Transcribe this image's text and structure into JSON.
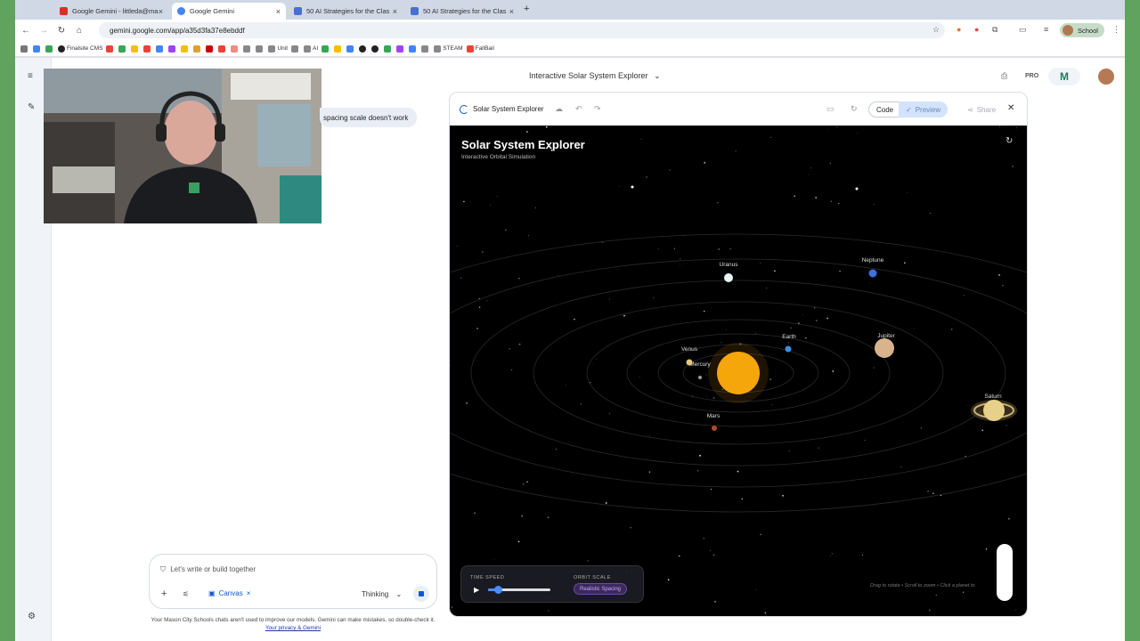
{
  "browser": {
    "tabs": [
      {
        "label": "Google Gemini - littleda@ma",
        "color": "#d93025"
      },
      {
        "label": "Google Gemini",
        "color": "#4285f4"
      },
      {
        "label": "50 AI Strategies for the Clas",
        "color": "#4a6fd1"
      },
      {
        "label": "50 AI Strategies for the Clas",
        "color": "#4a6fd1"
      }
    ],
    "new_tab": "+",
    "url": "gemini.google.com/app/a35d3fa37e8ebddf",
    "profile": "School",
    "bookmarks": [
      "Finalsite CMS",
      "Unit",
      "AI",
      "STEAM",
      "FallBail"
    ]
  },
  "gemini": {
    "doc_title": "Interactive Solar System Explorer",
    "pro_badge": "PRO",
    "logo_letter": "M",
    "user_message": "spacing scale doesn't work",
    "composer": {
      "placeholder": "Let's write or build together",
      "canvas_chip": "Canvas",
      "mode": "Thinking"
    },
    "disclaimer": "Your Mason City Schools chats aren't used to improve our models. Gemini can make mistakes, so double-check it.",
    "disclaimer_link": "Your privacy & Gemini"
  },
  "canvas": {
    "title": "Solar System Explorer",
    "code_label": "Code",
    "preview_label": "Preview",
    "share_label": "Share",
    "sim": {
      "title": "Solar System Explorer",
      "subtitle": "Interactive Orbital Simulation",
      "time_speed_label": "TIME SPEED",
      "time_speed_value": 0.15,
      "orbit_scale_label": "ORBIT SCALE",
      "orbit_scale_value": "Realistic Spacing",
      "hint": "Drag to rotate • Scroll to zoom • Click a planet to",
      "planets": [
        {
          "name": "Mercury",
          "color": "#9a9a9a"
        },
        {
          "name": "Venus",
          "color": "#e8c87a"
        },
        {
          "name": "Earth",
          "color": "#3b8fe0"
        },
        {
          "name": "Mars",
          "color": "#b5482c"
        },
        {
          "name": "Jupiter",
          "color": "#d9b38c"
        },
        {
          "name": "Saturn",
          "color": "#e6d08a"
        },
        {
          "name": "Uranus",
          "color": "#e8f4f8"
        },
        {
          "name": "Neptune",
          "color": "#3f6fe0"
        }
      ],
      "sun_color": "#f5a60a"
    }
  }
}
